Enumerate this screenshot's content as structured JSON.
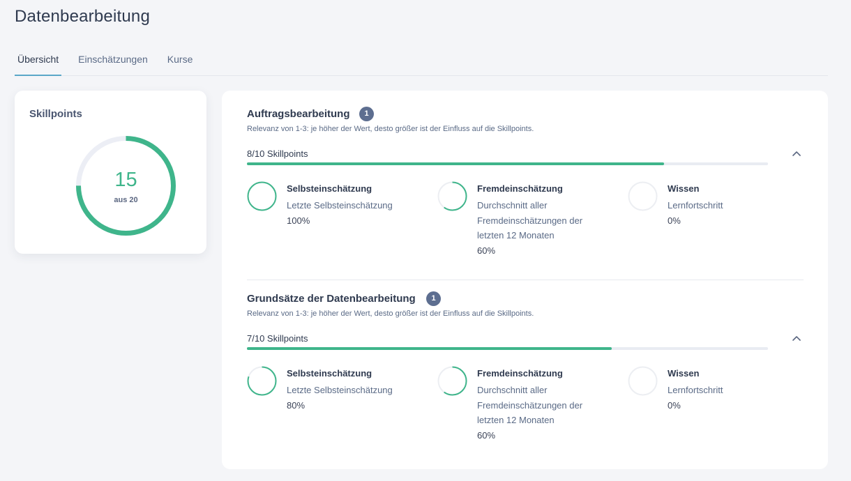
{
  "page": {
    "title": "Datenbearbeitung"
  },
  "tabs": [
    {
      "label": "Übersicht",
      "active": true
    },
    {
      "label": "Einschätzungen",
      "active": false
    },
    {
      "label": "Kurse",
      "active": false
    }
  ],
  "skillpoints": {
    "title": "Skillpoints",
    "value": "15",
    "sub": "aus 20",
    "fraction": 0.75,
    "color": "#3fb58b",
    "track_color": "#eceef5"
  },
  "sections": [
    {
      "title": "Auftragsbearbeitung",
      "badge": "1",
      "description": "Relevanz von 1-3: je höher der Wert, desto größer ist der Einfluss auf die Skillpoints.",
      "points_label": "8/10 Skillpoints",
      "progress": 0.8,
      "chevron": "chevron-up-icon",
      "metrics": [
        {
          "title": "Selbsteinschätzung",
          "desc": "Letzte Selbsteinschätzung",
          "value": "100%",
          "fraction": 1.0
        },
        {
          "title": "Fremdeinschätzung",
          "desc": "Durchschnitt aller Fremdeinschätzungen der letzten 12 Monaten",
          "value": "60%",
          "fraction": 0.6
        },
        {
          "title": "Wissen",
          "desc": "Lernfortschritt",
          "value": "0%",
          "fraction": 0.0
        }
      ]
    },
    {
      "title": "Grundsätze der Datenbearbeitung",
      "badge": "1",
      "description": "Relevanz von 1-3: je höher der Wert, desto größer ist der Einfluss auf die Skillpoints.",
      "points_label": "7/10 Skillpoints",
      "progress": 0.7,
      "chevron": "chevron-up-icon",
      "metrics": [
        {
          "title": "Selbsteinschätzung",
          "desc": "Letzte Selbsteinschätzung",
          "value": "80%",
          "fraction": 0.8
        },
        {
          "title": "Fremdeinschätzung",
          "desc": "Durchschnitt aller Fremdeinschätzungen der letzten 12 Monaten",
          "value": "60%",
          "fraction": 0.6
        },
        {
          "title": "Wissen",
          "desc": "Lernfortschritt",
          "value": "0%",
          "fraction": 0.0
        }
      ]
    }
  ]
}
